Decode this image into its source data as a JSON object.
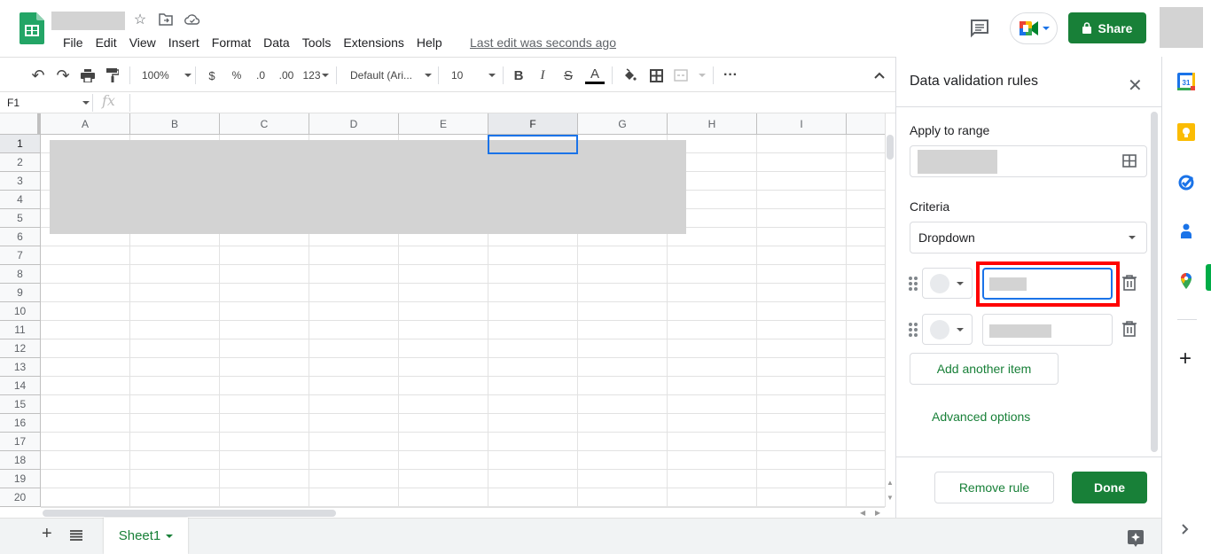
{
  "header": {
    "menu": [
      "File",
      "Edit",
      "View",
      "Insert",
      "Format",
      "Data",
      "Tools",
      "Extensions",
      "Help"
    ],
    "last_edit": "Last edit was seconds ago",
    "share_label": "Share"
  },
  "toolbar": {
    "zoom": "100%",
    "currency": "$",
    "percent": "%",
    "decrease_decimal": ".0",
    "increase_decimal": ".00",
    "more_formats": "123",
    "font": "Default (Ari...",
    "font_size": "10"
  },
  "formula_bar": {
    "cell_ref": "F1",
    "fx_label": "fx"
  },
  "grid": {
    "columns": [
      "A",
      "B",
      "C",
      "D",
      "E",
      "F",
      "G",
      "H",
      "I"
    ],
    "rows": [
      "1",
      "2",
      "3",
      "4",
      "5",
      "6",
      "7",
      "8",
      "9",
      "10",
      "11",
      "12",
      "13",
      "14",
      "15",
      "16",
      "17",
      "18",
      "19",
      "20"
    ],
    "selected_cell": "F1"
  },
  "sheets": {
    "tabs": [
      "Sheet1"
    ],
    "active": "Sheet1"
  },
  "panel": {
    "title": "Data validation rules",
    "apply_label": "Apply to range",
    "criteria_label": "Criteria",
    "criteria_value": "Dropdown",
    "add_item": "Add another item",
    "advanced": "Advanced options",
    "remove_rule": "Remove rule",
    "done": "Done"
  },
  "colors": {
    "brand_green": "#188038",
    "focus_blue": "#1a73e8",
    "highlight_red": "#ff0000"
  }
}
